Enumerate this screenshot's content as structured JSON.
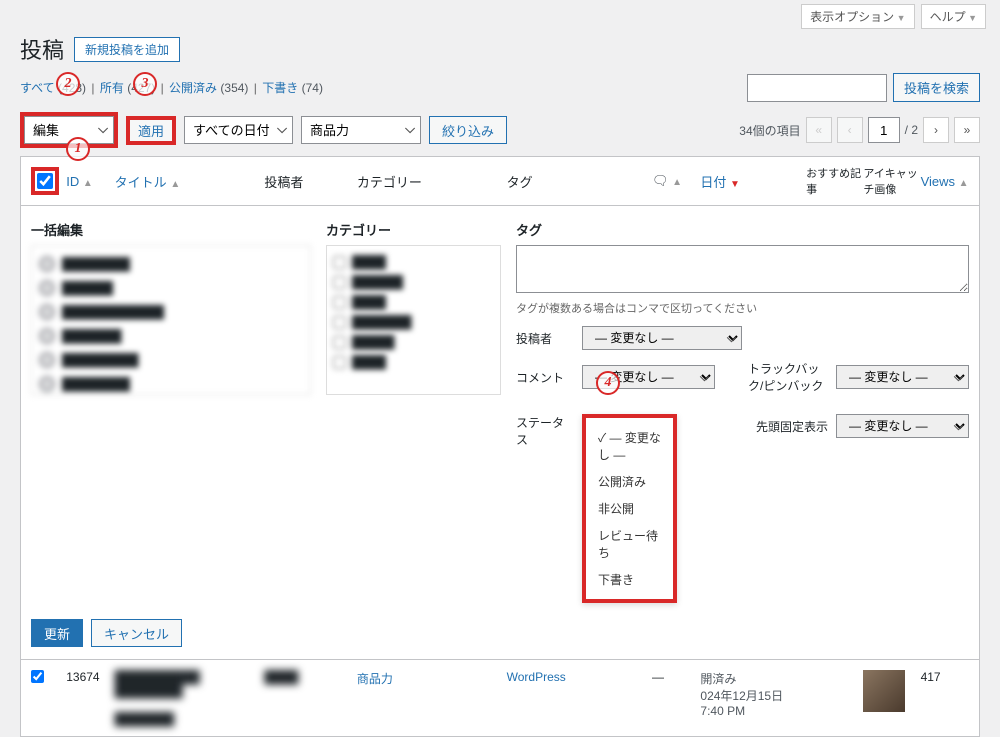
{
  "top": {
    "display_options": "表示オプション",
    "help": "ヘルプ"
  },
  "header": {
    "page_title": "投稿",
    "add_new": "新規投稿を追加"
  },
  "subsub": {
    "all_label": "すべて",
    "all_count": "(428)",
    "mine_label": "所有",
    "mine_count": "(427)",
    "published_label": "公開済み",
    "published_count": "(354)",
    "draft_label": "下書き",
    "draft_count": "(74)",
    "search_btn": "投稿を検索"
  },
  "filters": {
    "bulk_action": "編集",
    "apply": "適用",
    "all_dates": "すべての日付",
    "category": "商品力",
    "filter_btn": "絞り込み",
    "item_count": "34個の項目",
    "current_page": "1",
    "total_pages": "/ 2"
  },
  "columns": {
    "id": "ID",
    "title": "タイトル",
    "author": "投稿者",
    "category": "カテゴリー",
    "tag": "タグ",
    "date": "日付",
    "recommend": "おすすめ記事",
    "thumbnail": "アイキャッチ画像",
    "views": "Views"
  },
  "bulk_edit": {
    "title": "一括編集",
    "category": "カテゴリー",
    "tag": "タグ",
    "tag_hint": "タグが複数ある場合はコンマで区切ってください",
    "author_label": "投稿者",
    "no_change": "— 変更なし —",
    "comment_label": "コメント",
    "trackback_label": "トラックバック/ピンバック",
    "status_label": "ステータス",
    "sticky_label": "先頭固定表示",
    "update": "更新",
    "cancel": "キャンセル",
    "status_options": {
      "no_change": "— 変更なし —",
      "published": "公開済み",
      "private": "非公開",
      "pending": "レビュー待ち",
      "draft": "下書き"
    }
  },
  "post": {
    "id": "13674",
    "category": "商品力",
    "tag": "WordPress",
    "date_status": "開済み",
    "date": "024年12月15日 7:40 PM",
    "views": "417"
  },
  "markers": {
    "m1": "1",
    "m2": "2",
    "m3": "3",
    "m4": "4"
  }
}
